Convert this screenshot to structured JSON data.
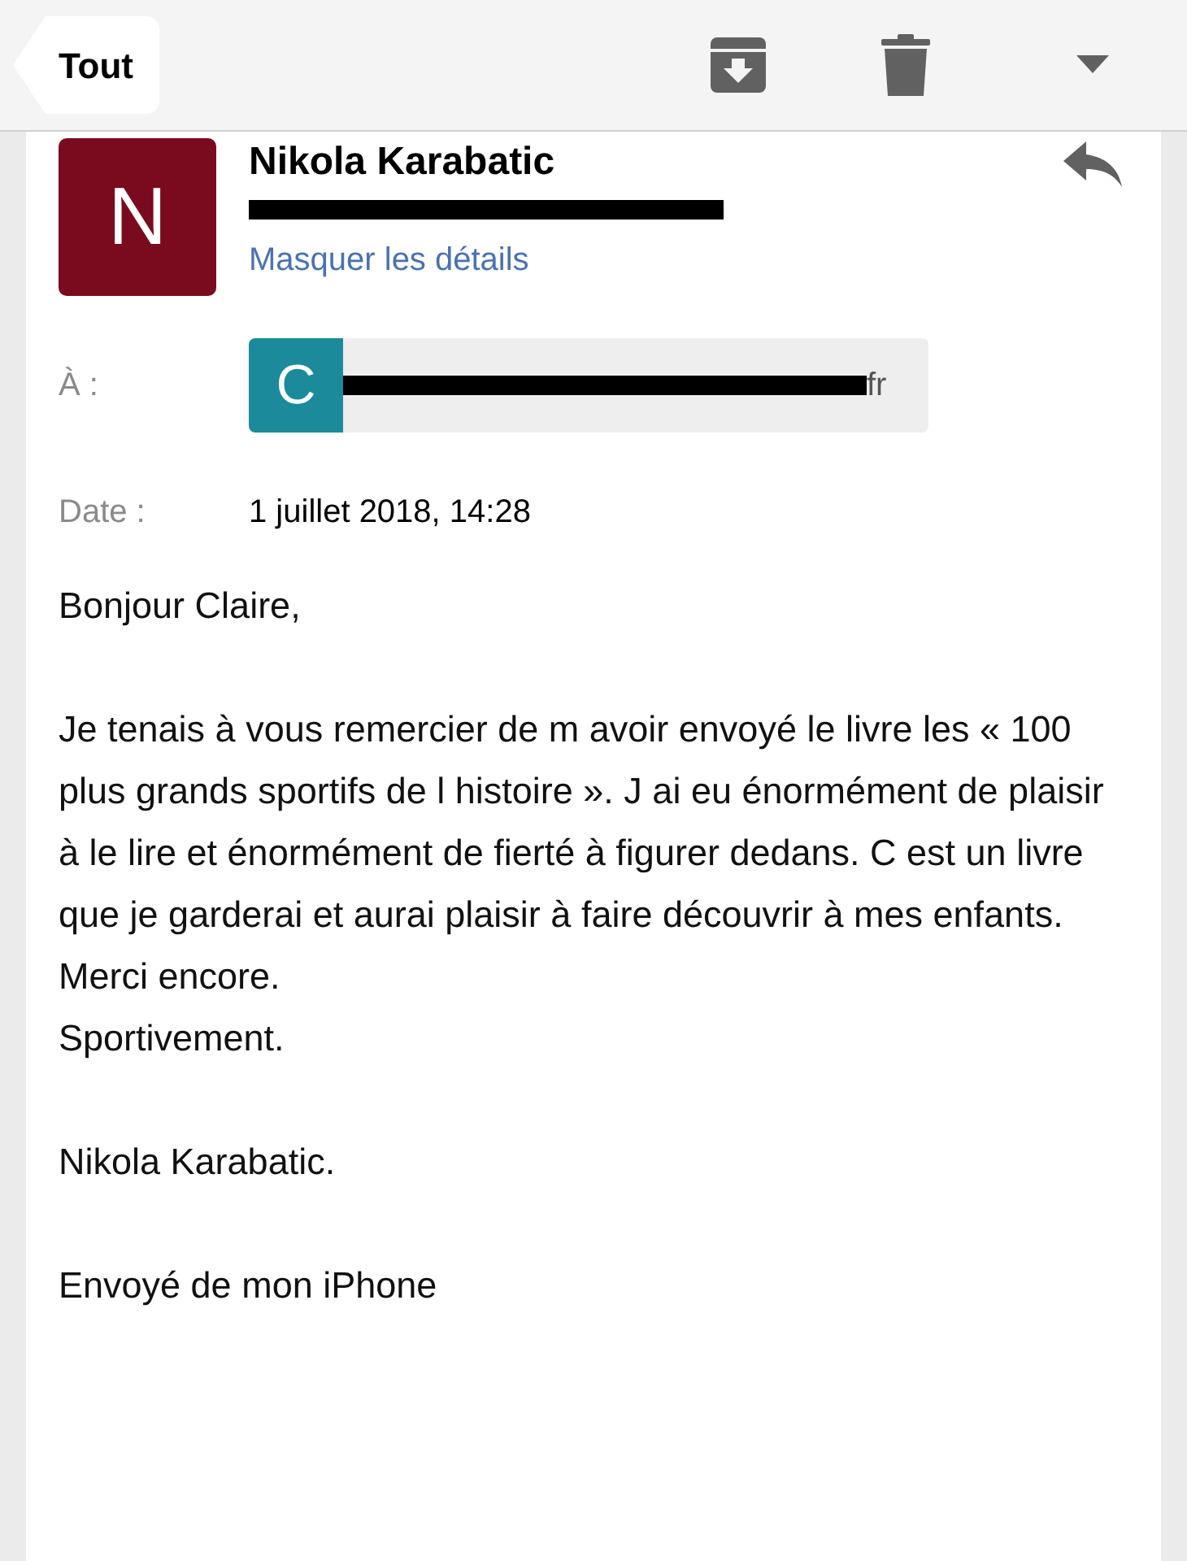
{
  "toolbar": {
    "back_label": "Tout"
  },
  "sender": {
    "initial": "N",
    "color": "#7a0a1e",
    "name": "Nikola Karabatic",
    "details_link": "Masquer les détails"
  },
  "recipient": {
    "label": "À :",
    "initial": "C",
    "color": "#1b8a9a",
    "address_tail": "fr"
  },
  "date": {
    "label": "Date :",
    "value": "1 juillet 2018, 14:28"
  },
  "body": [
    [
      "Bonjour Claire,"
    ],
    [
      "Je tenais à vous remercier de m avoir envoyé le livre les « 100 plus grands sportifs de l histoire ». J ai eu énormément de plaisir à le lire et énormément de fierté à figurer dedans. C est un livre que je garderai et aurai plaisir à faire découvrir à mes enfants.",
      "Merci encore.",
      "Sportivement."
    ],
    [
      "Nikola Karabatic."
    ],
    [
      "Envoyé de mon iPhone"
    ]
  ]
}
